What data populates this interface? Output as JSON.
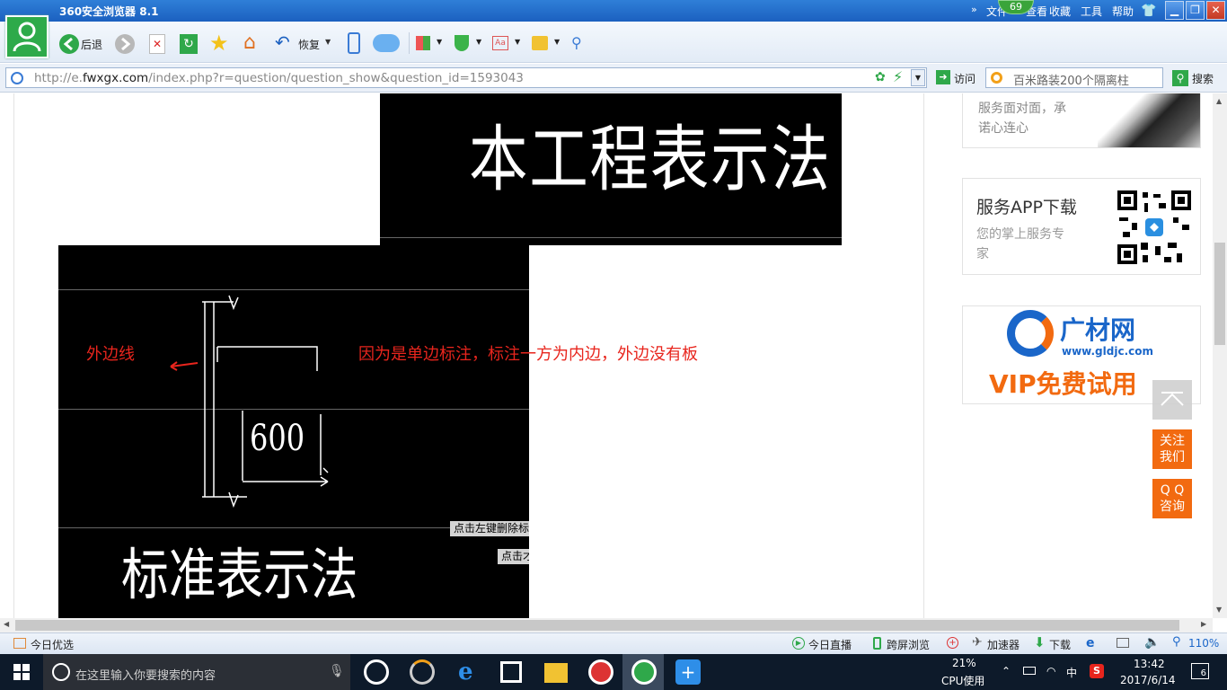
{
  "browser": {
    "title": "360安全浏览器 8.1",
    "menu": [
      "文件",
      "查看",
      "收藏",
      "工具",
      "帮助"
    ],
    "badge_count": "69"
  },
  "toolbar": {
    "back_label": "后退",
    "restore_label": "恢复"
  },
  "address": {
    "url_prefix": "http://e.",
    "url_domain": "fwxgx.com",
    "url_rest": "/index.php?r=question/question_show&question_id=1593043",
    "visit_label": "访问",
    "search_placeholder": "百米路装200个隔离柱",
    "search_label": "搜索"
  },
  "main": {
    "cad_top_text": "本工程表示法",
    "annotation_outer": "外边线",
    "annotation_note": "因为是单边标注，标注一方为内边，外边没有板",
    "dimension": "600",
    "cad_bottom_text": "标准表示法",
    "overlay_tip1": "点击左键删除标",
    "overlay_tip2": "点击才"
  },
  "sidebar": {
    "card1_line1": "服务面对面，承",
    "card1_line2": "诺心连心",
    "app_title": "服务APP下载",
    "app_sub1": "您的掌上服务专",
    "app_sub2": "家",
    "ad_brand": "广材网",
    "ad_url": "www.gldjc.com",
    "ad_vip": "VIP免费试用"
  },
  "float": {
    "follow_line1": "关注",
    "follow_line2": "我们",
    "qq_line1": "Q Q",
    "qq_line2": "咨询"
  },
  "statusbar": {
    "today": "今日优选",
    "live": "今日直播",
    "cross_screen": "跨屏浏览",
    "accelerator": "加速器",
    "download": "下载",
    "zoom": "110%"
  },
  "taskbar": {
    "search_placeholder": "在这里输入你要搜索的内容",
    "cpu_percent": "21%",
    "cpu_label": "CPU使用",
    "ime": "中",
    "time": "13:42",
    "date": "2017/6/14",
    "notifications": "6"
  },
  "colors": {
    "accent_red": "#e8251d",
    "float_orange": "#f26a10",
    "title_blue": "#1b60c0"
  }
}
